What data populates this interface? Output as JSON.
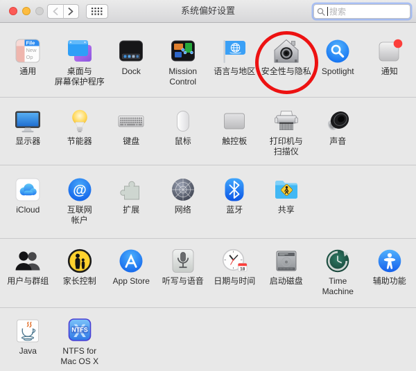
{
  "window": {
    "title": "系统偏好设置",
    "search_placeholder": "搜索"
  },
  "colors": {
    "annotation_red": "#ed1212",
    "traffic_close": "#fc5b57",
    "traffic_minimize": "#fdbc40",
    "traffic_zoom_disabled": "#d1d1d1",
    "focus_ring": "#7da3fa"
  },
  "icon_text": {
    "general_menu_title": "File",
    "general_menu_line2": "New",
    "general_menu_line3": "Op",
    "internet_at": "@",
    "calendar_day": "18",
    "ntfs_big_x": "X",
    "ntfs_label": "NTFS"
  },
  "annotation": {
    "shape": "ellipse",
    "color": "#ed1212",
    "target": "security-privacy"
  },
  "rows": [
    {
      "id": "personal",
      "items": [
        {
          "id": "general",
          "label": "通用",
          "icon": "general"
        },
        {
          "id": "desktop-screensaver",
          "label": "桌面与\n屏幕保护程序",
          "icon": "desktop"
        },
        {
          "id": "dock",
          "label": "Dock",
          "icon": "dock"
        },
        {
          "id": "mission-control",
          "label": "Mission\nControl",
          "icon": "mission"
        },
        {
          "id": "language-region",
          "label": "语言与地区",
          "icon": "language"
        },
        {
          "id": "security-privacy",
          "label": "安全性与隐私",
          "icon": "security",
          "annotated": true
        },
        {
          "id": "spotlight",
          "label": "Spotlight",
          "icon": "spotlight"
        },
        {
          "id": "notifications",
          "label": "通知",
          "icon": "notifications"
        }
      ]
    },
    {
      "id": "hardware",
      "items": [
        {
          "id": "displays",
          "label": "显示器",
          "icon": "displays"
        },
        {
          "id": "energy-saver",
          "label": "节能器",
          "icon": "energy"
        },
        {
          "id": "keyboard",
          "label": "键盘",
          "icon": "keyboard"
        },
        {
          "id": "mouse",
          "label": "鼠标",
          "icon": "mouse"
        },
        {
          "id": "trackpad",
          "label": "触控板",
          "icon": "trackpad"
        },
        {
          "id": "printers-scanners",
          "label": "打印机与\n扫描仪",
          "icon": "printer"
        },
        {
          "id": "sound",
          "label": "声音",
          "icon": "sound"
        }
      ]
    },
    {
      "id": "internet-wireless",
      "items": [
        {
          "id": "icloud",
          "label": "iCloud",
          "icon": "icloud"
        },
        {
          "id": "internet-accounts",
          "label": "互联网\n帐户",
          "icon": "internet"
        },
        {
          "id": "extensions",
          "label": "扩展",
          "icon": "extensions"
        },
        {
          "id": "network",
          "label": "网络",
          "icon": "network"
        },
        {
          "id": "bluetooth",
          "label": "蓝牙",
          "icon": "bluetooth"
        },
        {
          "id": "sharing",
          "label": "共享",
          "icon": "sharing"
        }
      ]
    },
    {
      "id": "system",
      "items": [
        {
          "id": "users-groups",
          "label": "用户与群组",
          "icon": "users"
        },
        {
          "id": "parental-controls",
          "label": "家长控制",
          "icon": "parental"
        },
        {
          "id": "app-store",
          "label": "App Store",
          "icon": "appstore"
        },
        {
          "id": "dictation-speech",
          "label": "听写与语音",
          "icon": "dictation"
        },
        {
          "id": "date-time",
          "label": "日期与时间",
          "icon": "datetime"
        },
        {
          "id": "startup-disk",
          "label": "启动磁盘",
          "icon": "startup"
        },
        {
          "id": "time-machine",
          "label": "Time Machine",
          "icon": "timemachine"
        },
        {
          "id": "accessibility",
          "label": "辅助功能",
          "icon": "accessibility"
        }
      ]
    },
    {
      "id": "other",
      "items": [
        {
          "id": "java",
          "label": "Java",
          "icon": "java"
        },
        {
          "id": "ntfs-for-mac",
          "label": "NTFS for\nMac OS X",
          "icon": "ntfs"
        }
      ]
    }
  ]
}
